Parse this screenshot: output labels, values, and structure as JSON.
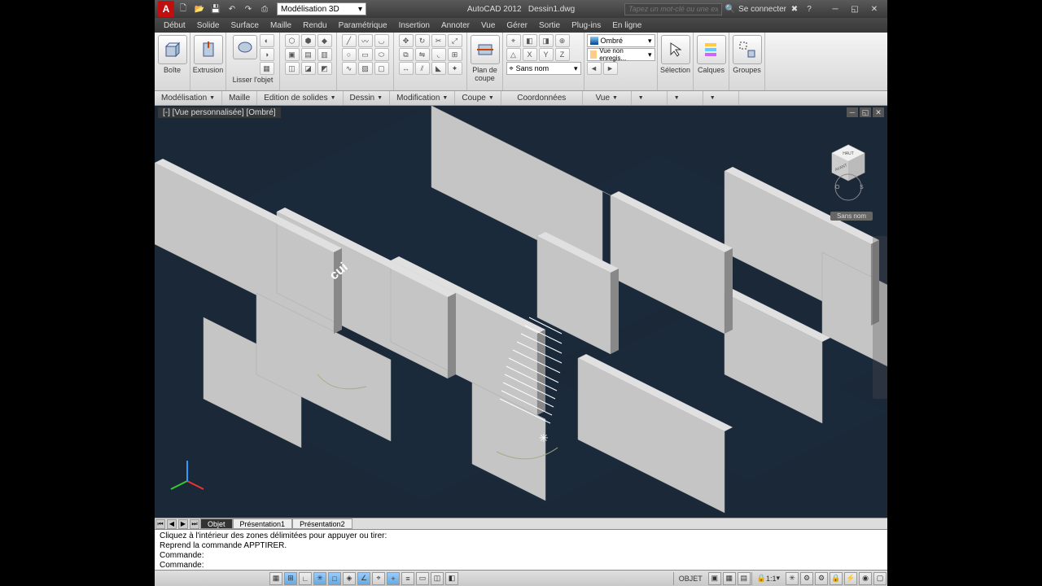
{
  "title": {
    "app": "AutoCAD 2012",
    "file": "Dessin1.dwg"
  },
  "workspace": "Modélisation 3D",
  "search_placeholder": "Tapez un mot-clé ou une expression",
  "signin": "Se connecter",
  "menu": [
    "Début",
    "Solide",
    "Surface",
    "Maille",
    "Rendu",
    "Paramétrique",
    "Insertion",
    "Annoter",
    "Vue",
    "Gérer",
    "Sortie",
    "Plug-ins",
    "En ligne"
  ],
  "ribbon": {
    "boite": "Boîte",
    "extrusion": "Extrusion",
    "lisser": "Lisser l'objet",
    "plan": "Plan de coupe",
    "selection": "Sélection",
    "calques": "Calques",
    "groupes": "Groupes",
    "visual_style": "Ombré",
    "view_unsaved": "Vue non enregis...",
    "ucs_noname": "Sans nom"
  },
  "panel_tabs": [
    "Modélisation",
    "Maille",
    "Edition de solides",
    "Dessin",
    "Modification",
    "Coupe",
    "Coordonnées",
    "Vue"
  ],
  "viewport": {
    "title": "[-] [Vue personnalisée] [Ombré]",
    "text3d": "cui",
    "vc_label": "Sans nom"
  },
  "model_tabs": {
    "active": "Objet",
    "p1": "Présentation1",
    "p2": "Présentation2"
  },
  "cmd": {
    "l1": "Cliquez à l'intérieur des zones délimitées pour appuyer ou tirer:",
    "l2": "Reprend la commande APPTIRER.",
    "l3": "Commande:",
    "l4": "Commande:"
  },
  "status": {
    "objet": "OBJET",
    "scale": "1:1"
  }
}
